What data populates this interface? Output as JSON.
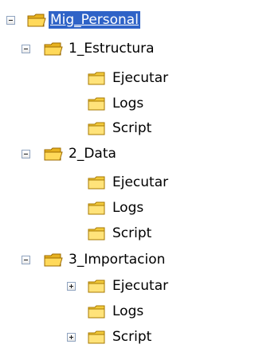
{
  "tree": {
    "root": "Mig_Personal",
    "sections": [
      {
        "label": "1_Estructura",
        "children": [
          "Ejecutar",
          "Logs",
          "Script"
        ]
      },
      {
        "label": "2_Data",
        "children": [
          "Ejecutar",
          "Logs",
          "Script"
        ]
      },
      {
        "label": "3_Importacion",
        "children": [
          "Ejecutar",
          "Logs",
          "Script"
        ]
      }
    ]
  },
  "colors": {
    "selection": "#2f63c7",
    "folder": "#f2ca3b",
    "folder_dark": "#d69b00",
    "toggle_border": "#8fa3bf"
  }
}
